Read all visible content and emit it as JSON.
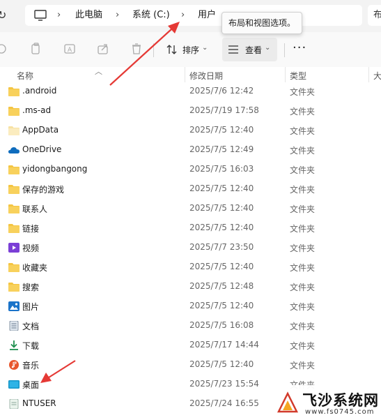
{
  "address_bar": {
    "crumbs": [
      "此电脑",
      "系统 (C:)",
      "用户"
    ],
    "right_partial": "布"
  },
  "toolbar": {
    "sort_label": "排序",
    "view_label": "查看",
    "more_label": "···",
    "tooltip": "布局和视图选项。"
  },
  "columns": {
    "name": "名称",
    "date": "修改日期",
    "type": "类型",
    "size_partial": "大"
  },
  "files": [
    {
      "name": ".android",
      "date": "2025/7/6 12:42",
      "type": "文件夹",
      "icon": "folder-icon"
    },
    {
      "name": ".ms-ad",
      "date": "2025/7/19 17:58",
      "type": "文件夹",
      "icon": "folder-icon"
    },
    {
      "name": "AppData",
      "date": "2025/7/5 12:40",
      "type": "文件夹",
      "icon": "hidden-folder-icon"
    },
    {
      "name": "OneDrive",
      "date": "2025/7/5 12:49",
      "type": "文件夹",
      "icon": "onedrive-cloud-icon"
    },
    {
      "name": "yidongbangong",
      "date": "2025/7/5 16:03",
      "type": "文件夹",
      "icon": "folder-icon"
    },
    {
      "name": "保存的游戏",
      "date": "2025/7/5 12:40",
      "type": "文件夹",
      "icon": "folder-icon"
    },
    {
      "name": "联系人",
      "date": "2025/7/5 12:40",
      "type": "文件夹",
      "icon": "folder-icon"
    },
    {
      "name": "链接",
      "date": "2025/7/5 12:40",
      "type": "文件夹",
      "icon": "folder-icon"
    },
    {
      "name": "视频",
      "date": "2025/7/7 23:50",
      "type": "文件夹",
      "icon": "videos-icon"
    },
    {
      "name": "收藏夹",
      "date": "2025/7/5 12:40",
      "type": "文件夹",
      "icon": "folder-icon"
    },
    {
      "name": "搜索",
      "date": "2025/7/5 12:48",
      "type": "文件夹",
      "icon": "folder-icon"
    },
    {
      "name": "图片",
      "date": "2025/7/5 12:40",
      "type": "文件夹",
      "icon": "pictures-icon"
    },
    {
      "name": "文档",
      "date": "2025/7/5 16:08",
      "type": "文件夹",
      "icon": "documents-icon"
    },
    {
      "name": "下载",
      "date": "2025/7/17 14:44",
      "type": "文件夹",
      "icon": "downloads-icon"
    },
    {
      "name": "音乐",
      "date": "2025/7/5 12:40",
      "type": "文件夹",
      "icon": "music-icon"
    },
    {
      "name": "桌面",
      "date": "2025/7/23 15:54",
      "type": "文件夹",
      "icon": "desktop-icon"
    },
    {
      "name": "NTUSER",
      "date": "2025/7/24 16:55",
      "type": "",
      "icon": "file-icon"
    }
  ],
  "watermark": {
    "title": "飞沙系统网",
    "url": "www.fs0745.com"
  },
  "colors": {
    "folder": "#f4c542",
    "accent": "#0078d4",
    "arrow": "#e53935"
  }
}
